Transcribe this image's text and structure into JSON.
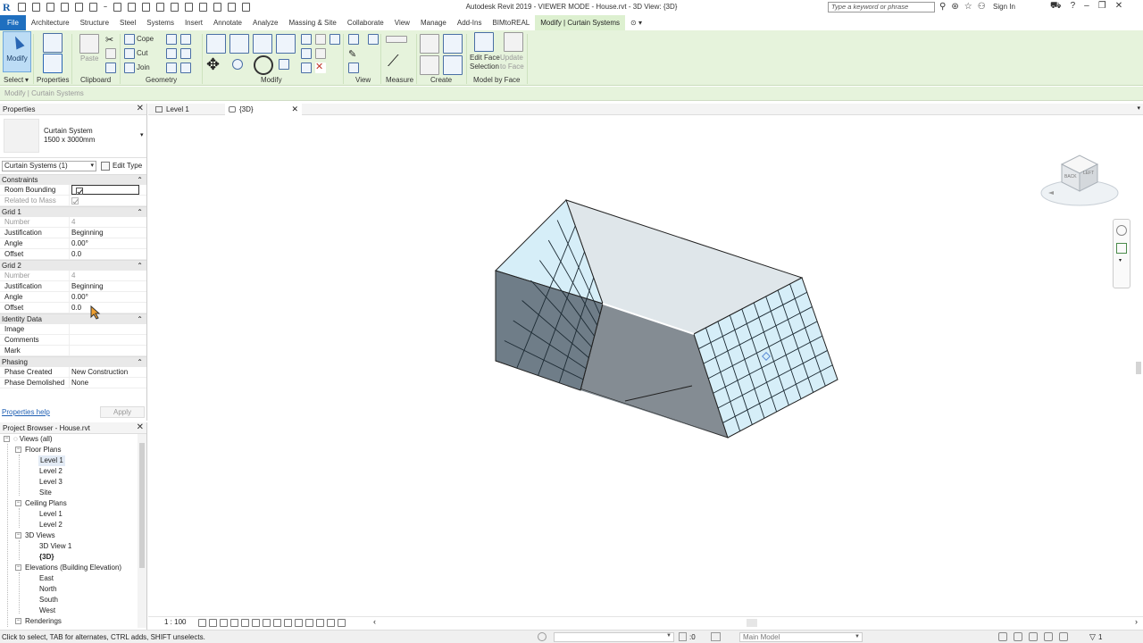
{
  "titlebar": {
    "title": "Autodesk Revit 2019 - VIEWER MODE - House.rvt - 3D View: {3D}",
    "search_placeholder": "Type a keyword or phrase",
    "sign_in": "Sign In"
  },
  "menu_tabs": [
    "File",
    "Architecture",
    "Structure",
    "Steel",
    "Systems",
    "Insert",
    "Annotate",
    "Analyze",
    "Massing & Site",
    "Collaborate",
    "View",
    "Manage",
    "Add-Ins",
    "BIMtoREAL",
    "Modify | Curtain Systems"
  ],
  "ribbon": {
    "modify_label": "Modify",
    "paste_label": "Paste",
    "cope_label": "Cope",
    "cut_label": "Cut",
    "join_label": "Join",
    "edit_face_selection_label": "Edit Face Selection",
    "update_to_face_label": "Update to Face",
    "panels": {
      "select": "Select",
      "properties": "Properties",
      "clipboard": "Clipboard",
      "geometry": "Geometry",
      "modify": "Modify",
      "view": "View",
      "measure": "Measure",
      "create": "Create",
      "model_by_face": "Model by Face"
    }
  },
  "options_bar": {
    "text": "Modify | Curtain Systems"
  },
  "properties": {
    "title": "Properties",
    "type_name_1": "Curtain System",
    "type_name_2": "1500 x 3000mm",
    "instance_filter": "Curtain Systems (1)",
    "edit_type": "Edit Type",
    "groups": [
      {
        "name": "Constraints",
        "rows": [
          {
            "key": "Room Bounding",
            "value": "",
            "checkbox": true,
            "checked": true,
            "dim": false,
            "editing": true
          },
          {
            "key": "Related to Mass",
            "value": "",
            "checkbox": true,
            "checked": true,
            "dim": true
          }
        ]
      },
      {
        "name": "Grid 1",
        "rows": [
          {
            "key": "Number",
            "value": "4",
            "dim": true
          },
          {
            "key": "Justification",
            "value": "Beginning"
          },
          {
            "key": "Angle",
            "value": "0.00°"
          },
          {
            "key": "Offset",
            "value": "0.0"
          }
        ]
      },
      {
        "name": "Grid 2",
        "rows": [
          {
            "key": "Number",
            "value": "4",
            "dim": true
          },
          {
            "key": "Justification",
            "value": "Beginning"
          },
          {
            "key": "Angle",
            "value": "0.00°"
          },
          {
            "key": "Offset",
            "value": "0.0"
          }
        ]
      },
      {
        "name": "Identity Data",
        "rows": [
          {
            "key": "Image",
            "value": ""
          },
          {
            "key": "Comments",
            "value": ""
          },
          {
            "key": "Mark",
            "value": ""
          }
        ]
      },
      {
        "name": "Phasing",
        "rows": [
          {
            "key": "Phase Created",
            "value": "New Construction"
          },
          {
            "key": "Phase Demolished",
            "value": "None"
          }
        ]
      }
    ],
    "help_link": "Properties help",
    "apply": "Apply"
  },
  "browser": {
    "title": "Project Browser - House.rvt",
    "root": "Views (all)",
    "floor_plans": "Floor Plans",
    "floor_items": [
      "Level 1",
      "Level 2",
      "Level 3",
      "Site"
    ],
    "ceiling_plans": "Ceiling Plans",
    "ceiling_items": [
      "Level 1",
      "Level 2"
    ],
    "views_3d": "3D Views",
    "views_3d_items": [
      "3D View 1",
      "{3D}"
    ],
    "elevations": "Elevations (Building Elevation)",
    "elevation_items": [
      "East",
      "North",
      "South",
      "West"
    ],
    "renderings": "Renderings"
  },
  "view_tabs": [
    {
      "label": "Level 1",
      "active": false
    },
    {
      "label": "{3D}",
      "active": true
    }
  ],
  "viewcube": {
    "face_back": "BACK",
    "face_left": "LEFT"
  },
  "view_control": {
    "scale": "1 : 100"
  },
  "status": {
    "hint": "Click to select, TAB for alternates, CTRL adds, SHIFT unselects.",
    "zero": ":0",
    "model": "Main Model",
    "filter_count": "1"
  },
  "colors": {
    "file_tab": "#1f6fbf",
    "ribbon_bg": "#e6f3dc",
    "context_tab": "#ddf0d0",
    "glass": "#d6eef8",
    "solid_face": "#8a9299"
  }
}
